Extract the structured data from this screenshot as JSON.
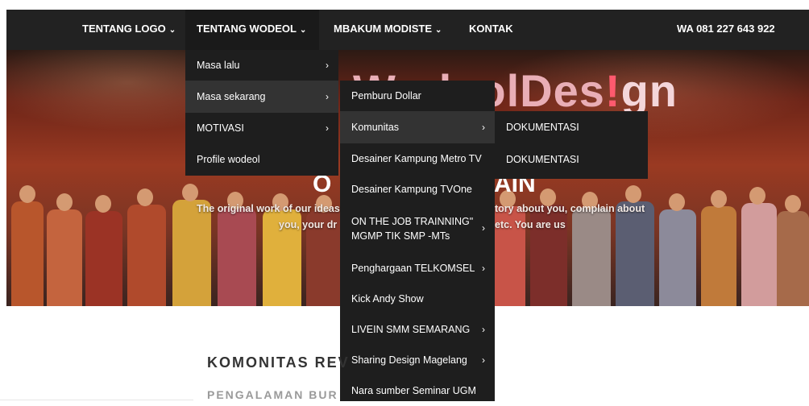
{
  "nav": {
    "items": [
      {
        "label": "TENTANG LOGO"
      },
      {
        "label": "TENTANG WODEOL"
      },
      {
        "label": "MBAKUM MODISTE"
      },
      {
        "label": "KONTAK"
      }
    ],
    "phone": "WA 081 227 643 922"
  },
  "hero": {
    "logo_part1": "WodeolDes",
    "logo_part2": "!",
    "logo_part3": "gn",
    "title_left": "O",
    "title_right": "AIN",
    "subtitle_line1_left": "The original work of our ideas",
    "subtitle_line1_right": "tory about you, complain about",
    "subtitle_line2_left": "you, your dr",
    "subtitle_line2_right": "etc. You are us"
  },
  "menu_wodeol": [
    {
      "label": "Masa lalu",
      "arrow": "›"
    },
    {
      "label": "Masa sekarang",
      "arrow": "›"
    },
    {
      "label": "MOTIVASI",
      "arrow": "›"
    },
    {
      "label": "Profile wodeol",
      "arrow": ""
    }
  ],
  "menu_sekarang": [
    {
      "label": "Pemburu Dollar",
      "arrow": ""
    },
    {
      "label": "Komunitas",
      "arrow": "›"
    },
    {
      "label": "Desainer Kampung Metro TV",
      "arrow": ""
    },
    {
      "label": "Desainer Kampung TVOne",
      "arrow": ""
    },
    {
      "label": "ON THE JOB TRAINNING\"",
      "label2": "MGMP TIK SMP -MTs",
      "arrow": "›"
    },
    {
      "label": "Penghargaan TELKOMSEL",
      "arrow": "›"
    },
    {
      "label": "Kick Andy Show",
      "arrow": ""
    },
    {
      "label": "LIVEIN SMM SEMARANG",
      "arrow": "›"
    },
    {
      "label": "Sharing Design Magelang",
      "arrow": "›"
    },
    {
      "label": "Nara sumber Seminar UGM",
      "arrow": ""
    }
  ],
  "menu_komunitas": [
    {
      "label": "DOKUMENTASI"
    },
    {
      "label": "DOKUMENTASI"
    }
  ],
  "content": {
    "section_title": "KOMONITAS REV",
    "section_subtitle": "PENGALAMAN BUR"
  }
}
